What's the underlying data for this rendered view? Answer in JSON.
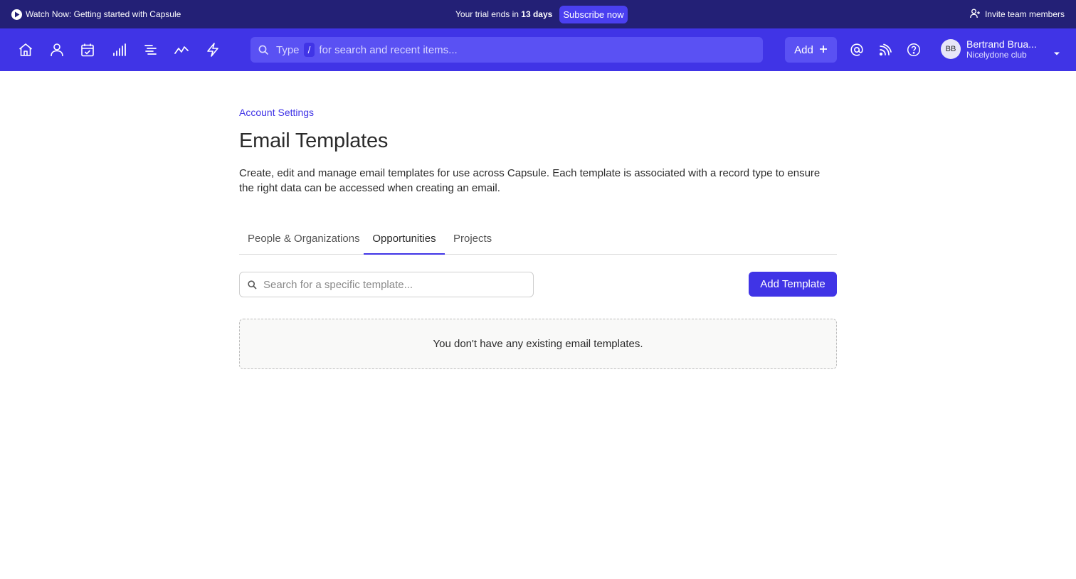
{
  "banner": {
    "watch_label": "Watch Now: Getting started with Capsule",
    "trial_prefix": "Your trial ends in",
    "trial_days": "13 days",
    "subscribe_label": "Subscribe now",
    "invite_label": "Invite team members"
  },
  "nav": {
    "icons": [
      "home-icon",
      "person-icon",
      "calendar-check-icon",
      "bar-chart-icon",
      "list-icon",
      "trend-line-icon",
      "lightning-icon"
    ],
    "search": {
      "prefix": "Type",
      "key": "/",
      "suffix": "for search and recent items..."
    },
    "add_label": "Add",
    "user": {
      "initials": "BB",
      "name": "Bertrand Brua...",
      "org": "Nicelydone club"
    }
  },
  "page": {
    "breadcrumb": "Account Settings",
    "title": "Email Templates",
    "description": "Create, edit and manage email templates for use across Capsule. Each template is associated with a record type to ensure the right data can be accessed when creating an email.",
    "tabs": [
      {
        "label": "People & Organizations",
        "active": false
      },
      {
        "label": "Opportunities",
        "active": true
      },
      {
        "label": "Projects",
        "active": false
      }
    ],
    "search_placeholder": "Search for a specific template...",
    "add_template_label": "Add Template",
    "empty_message": "You don't have any existing email templates."
  },
  "colors": {
    "banner_bg": "#232076",
    "nav_bg": "#4034e6",
    "accent": "#4a3ff0"
  }
}
